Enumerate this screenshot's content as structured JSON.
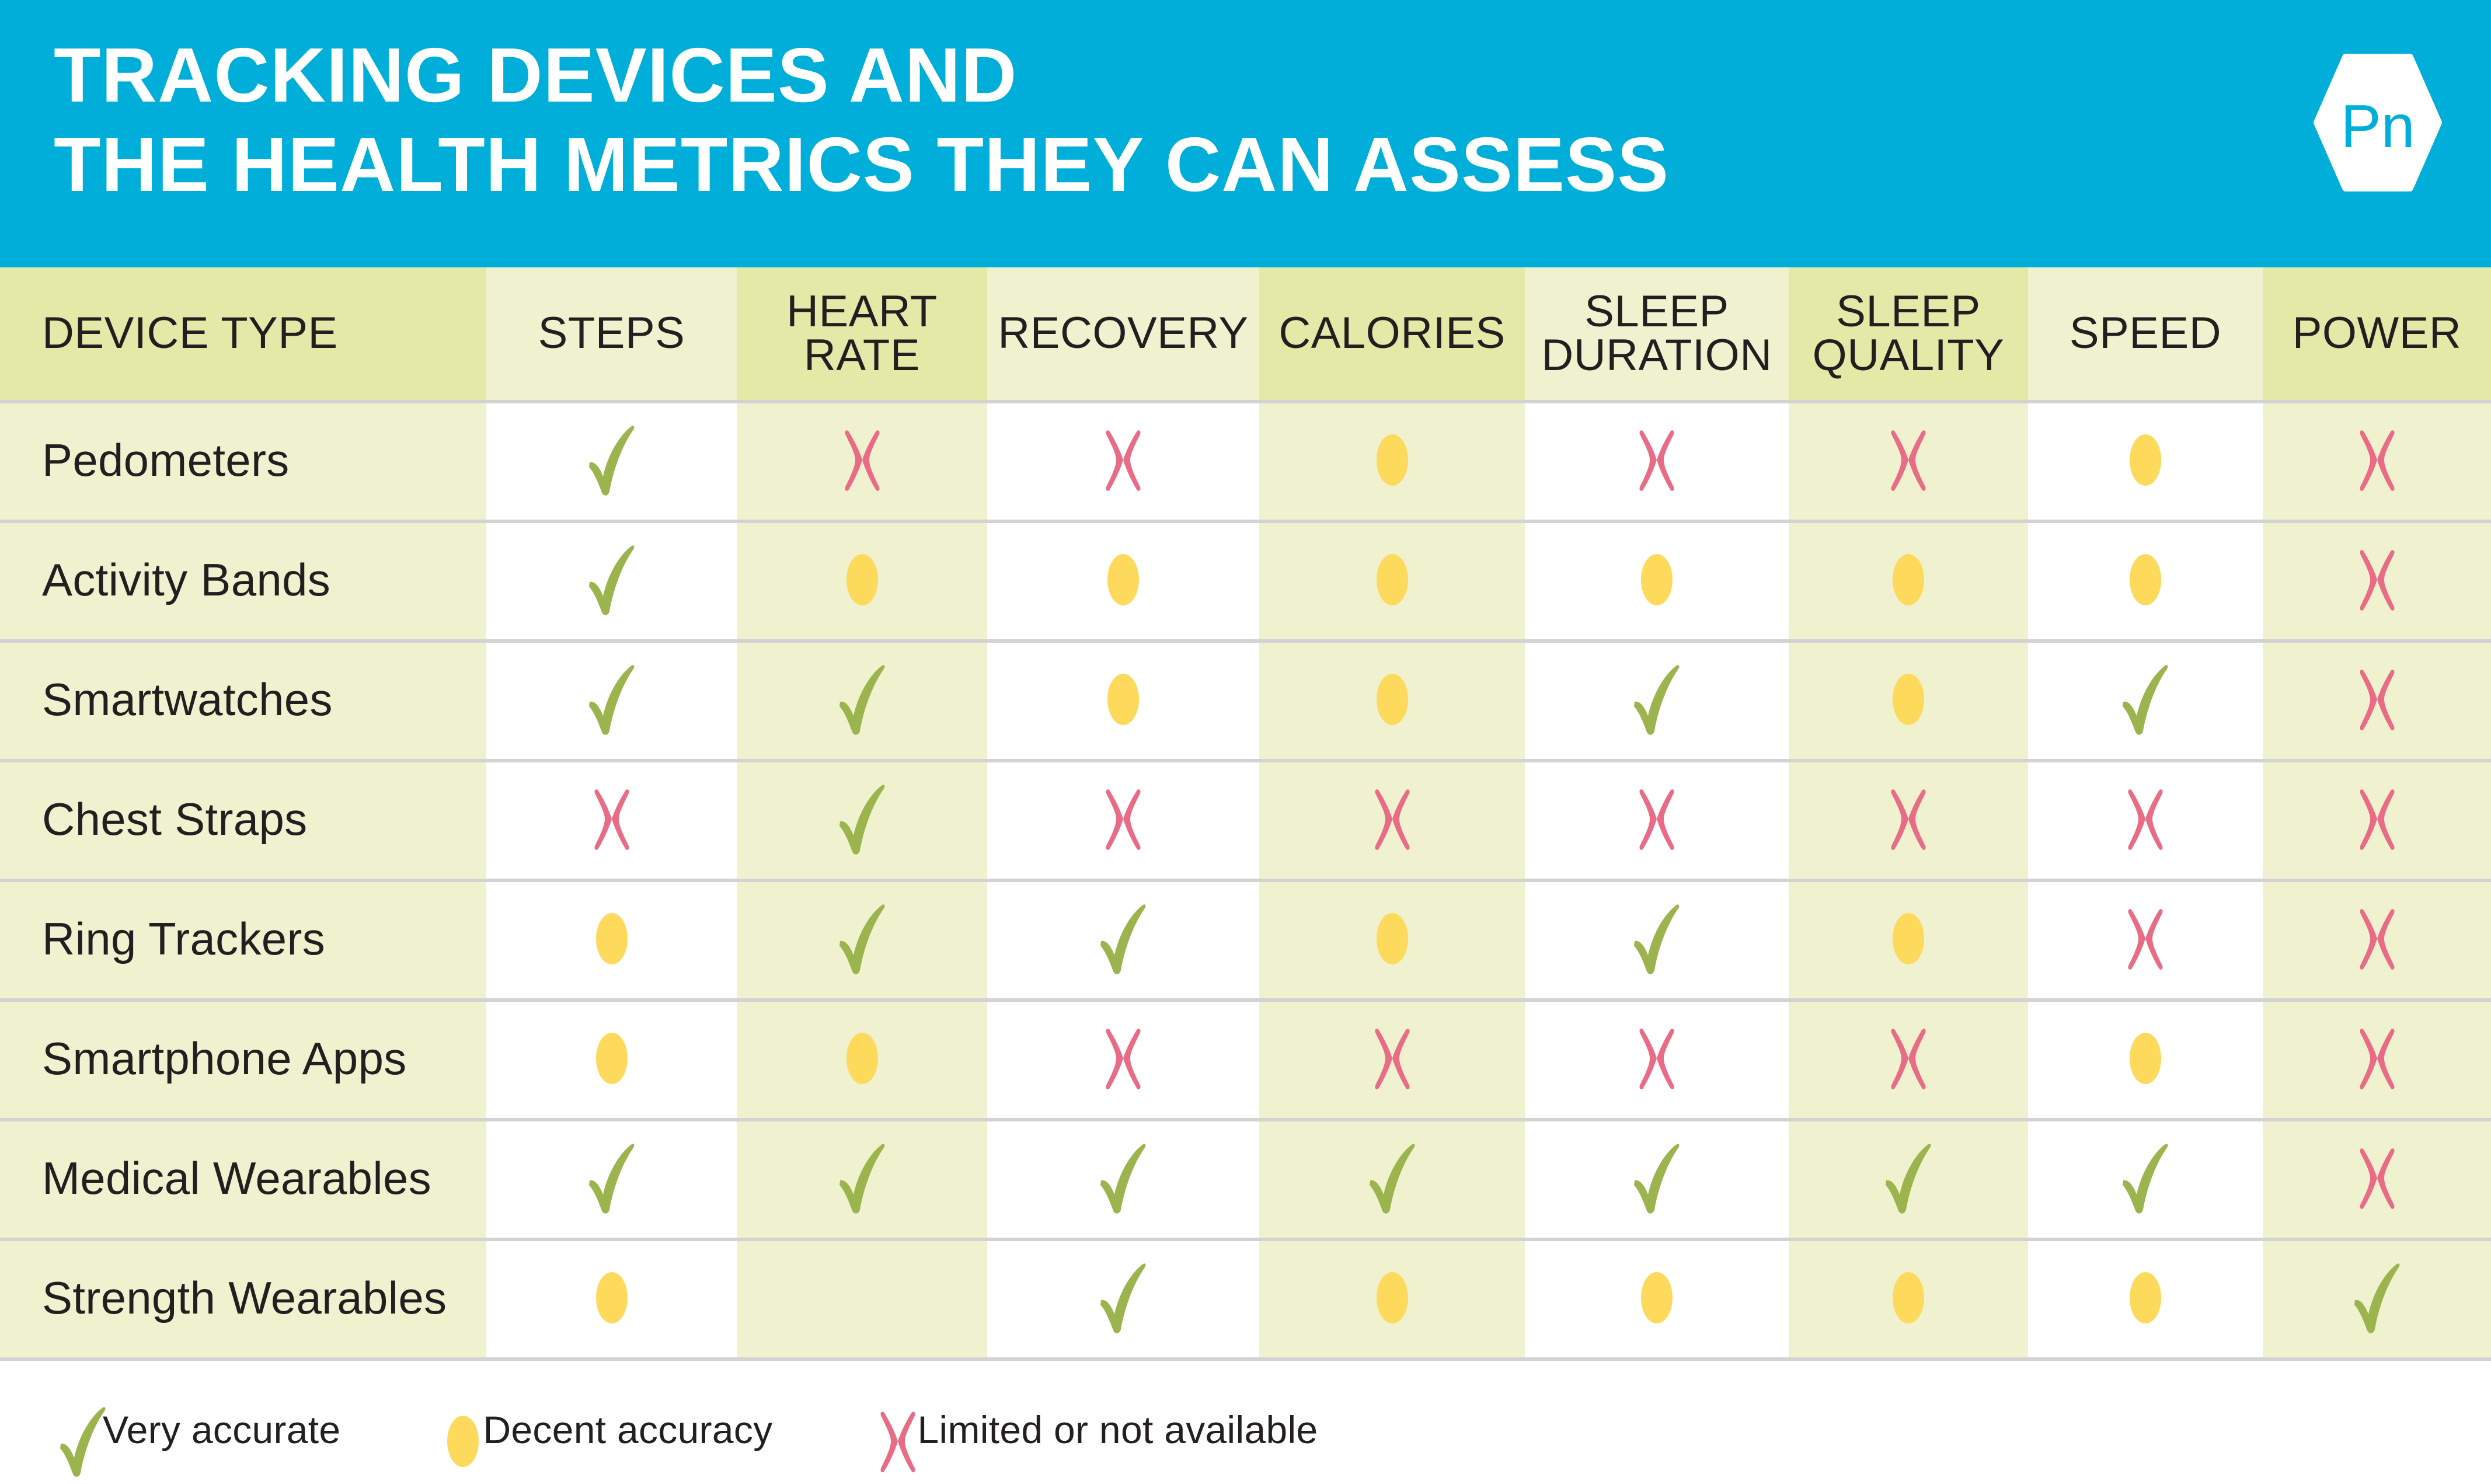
{
  "banner": {
    "title": "TRACKING DEVICES AND\nTHE HEALTH METRICS THEY CAN ASSESS",
    "logo_text": "Pn",
    "background_color": "#00aeda",
    "title_color": "#ffffff"
  },
  "colors": {
    "accent_cyan": "#00aeda",
    "header_shade_dark": "#e4e9a8",
    "header_shade_light": "#f0f2cf",
    "row_shade": "#f0f2cf",
    "row_white": "#ffffff",
    "divider": "#d2d4d4",
    "check_green": "#9cb44e",
    "dot_yellow": "#fdd95c",
    "cross_pink": "#ea6b85",
    "text_dark": "#231f20"
  },
  "chart_data": {
    "type": "table",
    "title": "TRACKING DEVICES AND THE HEALTH METRICS THEY CAN ASSESS",
    "columns": [
      "DEVICE TYPE",
      "STEPS",
      "HEART\nRATE",
      "RECOVERY",
      "CALORIES",
      "SLEEP\nDURATION",
      "SLEEP\nQUALITY",
      "SPEED",
      "POWER"
    ],
    "metric_columns": [
      "STEPS",
      "HEART RATE",
      "RECOVERY",
      "CALORIES",
      "SLEEP DURATION",
      "SLEEP QUALITY",
      "SPEED",
      "POWER"
    ],
    "rows": [
      {
        "device": "Pedometers",
        "values": [
          "check",
          "cross",
          "cross",
          "dot",
          "cross",
          "cross",
          "dot",
          "cross"
        ]
      },
      {
        "device": "Activity Bands",
        "values": [
          "check",
          "dot",
          "dot",
          "dot",
          "dot",
          "dot",
          "dot",
          "cross"
        ]
      },
      {
        "device": "Smartwatches",
        "values": [
          "check",
          "check",
          "dot",
          "dot",
          "check",
          "dot",
          "check",
          "cross"
        ]
      },
      {
        "device": "Chest Straps",
        "values": [
          "cross",
          "check",
          "cross",
          "cross",
          "cross",
          "cross",
          "cross",
          "cross"
        ]
      },
      {
        "device": "Ring Trackers",
        "values": [
          "dot",
          "check",
          "check",
          "dot",
          "check",
          "dot",
          "cross",
          "cross"
        ]
      },
      {
        "device": "Smartphone Apps",
        "values": [
          "dot",
          "dot",
          "cross",
          "cross",
          "cross",
          "cross",
          "dot",
          "cross"
        ]
      },
      {
        "device": "Medical Wearables",
        "values": [
          "check",
          "check",
          "check",
          "check",
          "check",
          "check",
          "check",
          "cross"
        ]
      },
      {
        "device": "Strength Wearables",
        "values": [
          "dot",
          "none",
          "check",
          "dot",
          "dot",
          "dot",
          "dot",
          "check"
        ]
      }
    ],
    "value_legend": {
      "check": "Very accurate",
      "dot": "Decent accuracy",
      "cross": "Limited or not available",
      "none": ""
    }
  },
  "legend": {
    "items": [
      {
        "mark": "check",
        "label": "Very accurate"
      },
      {
        "mark": "dot",
        "label": "Decent accuracy"
      },
      {
        "mark": "cross",
        "label": "Limited or not available"
      }
    ]
  }
}
